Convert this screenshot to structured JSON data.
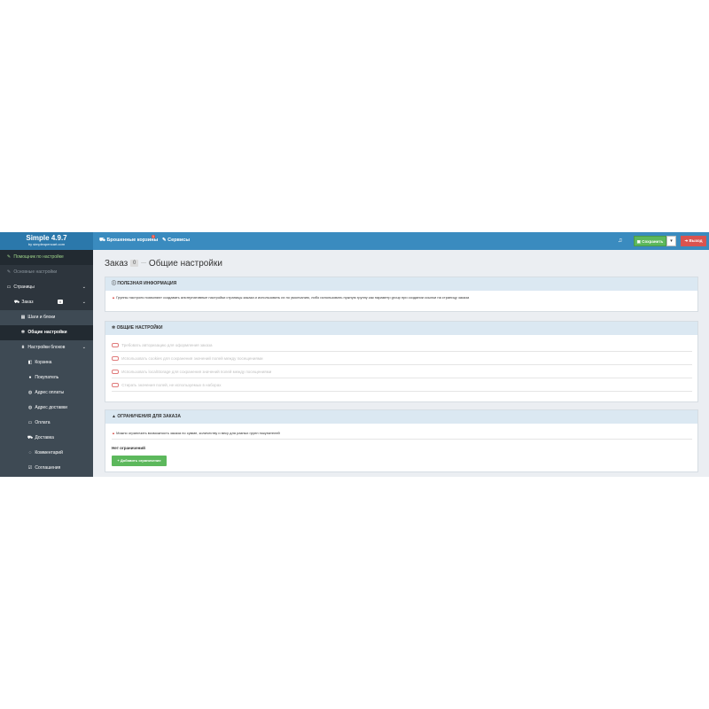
{
  "brand": {
    "title": "Simple 4.9.7",
    "subtitle": "by simpleopencart.com"
  },
  "topbar": {
    "cart_link": "Брошенные корзины",
    "cart_badge": "1",
    "service_link": "Сервисы",
    "save_label": "Сохранить",
    "exit_label": "Выход"
  },
  "sidebar": {
    "items": [
      {
        "label": "Помощник по настройке",
        "icon": "wrench-icon",
        "glyph": "✎"
      },
      {
        "label": "Основные настройки",
        "icon": "wrench-icon",
        "glyph": "✎"
      },
      {
        "label": "Страницы",
        "icon": "file-icon",
        "glyph": "▭"
      },
      {
        "label": "Заказ",
        "icon": "cart-icon",
        "glyph": "⛟",
        "count": "0"
      },
      {
        "label": "Шаги и блоки",
        "icon": "grid-icon",
        "glyph": "▦"
      },
      {
        "label": "Общие настройки",
        "icon": "gear-icon",
        "glyph": "✲"
      },
      {
        "label": "Настройки блоков",
        "icon": "sitemap-icon",
        "glyph": "⩩"
      },
      {
        "label": "Корзина",
        "icon": "basket-icon",
        "glyph": "◧"
      },
      {
        "label": "Покупатель",
        "icon": "user-icon",
        "glyph": "●"
      },
      {
        "label": "Адрес оплаты",
        "icon": "globe-icon",
        "glyph": "◍"
      },
      {
        "label": "Адрес доставки",
        "icon": "globe-icon",
        "glyph": "◍"
      },
      {
        "label": "Оплата",
        "icon": "credit-card-icon",
        "glyph": "▭"
      },
      {
        "label": "Доставка",
        "icon": "truck-icon",
        "glyph": "⛟"
      },
      {
        "label": "Комментарий",
        "icon": "comment-icon",
        "glyph": "◌"
      },
      {
        "label": "Соглашения",
        "icon": "check-square-icon",
        "glyph": "☑"
      }
    ]
  },
  "page": {
    "title": "Заказ",
    "count": "0",
    "separator": "—",
    "subtitle": "Общие настройки"
  },
  "panels": {
    "info": {
      "title": "ПОЛЕЗНАЯ ИНФОРМАЦИЯ",
      "text": "Группы настроек позволяют создавать альтернативные настройки страницы заказа и использовать их по умолчанию, либо использовать нужную группу как параметр group при создании ссылки на страницу заказа"
    },
    "general": {
      "title": "ОБЩИЕ НАСТРОЙКИ",
      "options": [
        "Требовать авторизацию для оформления заказа",
        "Использовать cookies для сохранения значений полей между посещениями",
        "Использовать localStorage для сохранения значений полей между посещениями",
        "Стирать значения полей, не используемых в наборах"
      ]
    },
    "limits": {
      "title": "ОГРАНИЧЕНИЯ ДЛЯ ЗАКАЗА",
      "warning": "Можно ограничить возможность заказа по сумме, количеству и весу для разных групп покупателей",
      "empty": "Нет ограничений",
      "add_label": "Добавить ограничение"
    }
  },
  "colors": {
    "topbar": "#3a8bbf",
    "sidebar": "#3e4a54",
    "success": "#5cb85c",
    "danger": "#d9534f",
    "panel_header": "#dbe8f2"
  }
}
